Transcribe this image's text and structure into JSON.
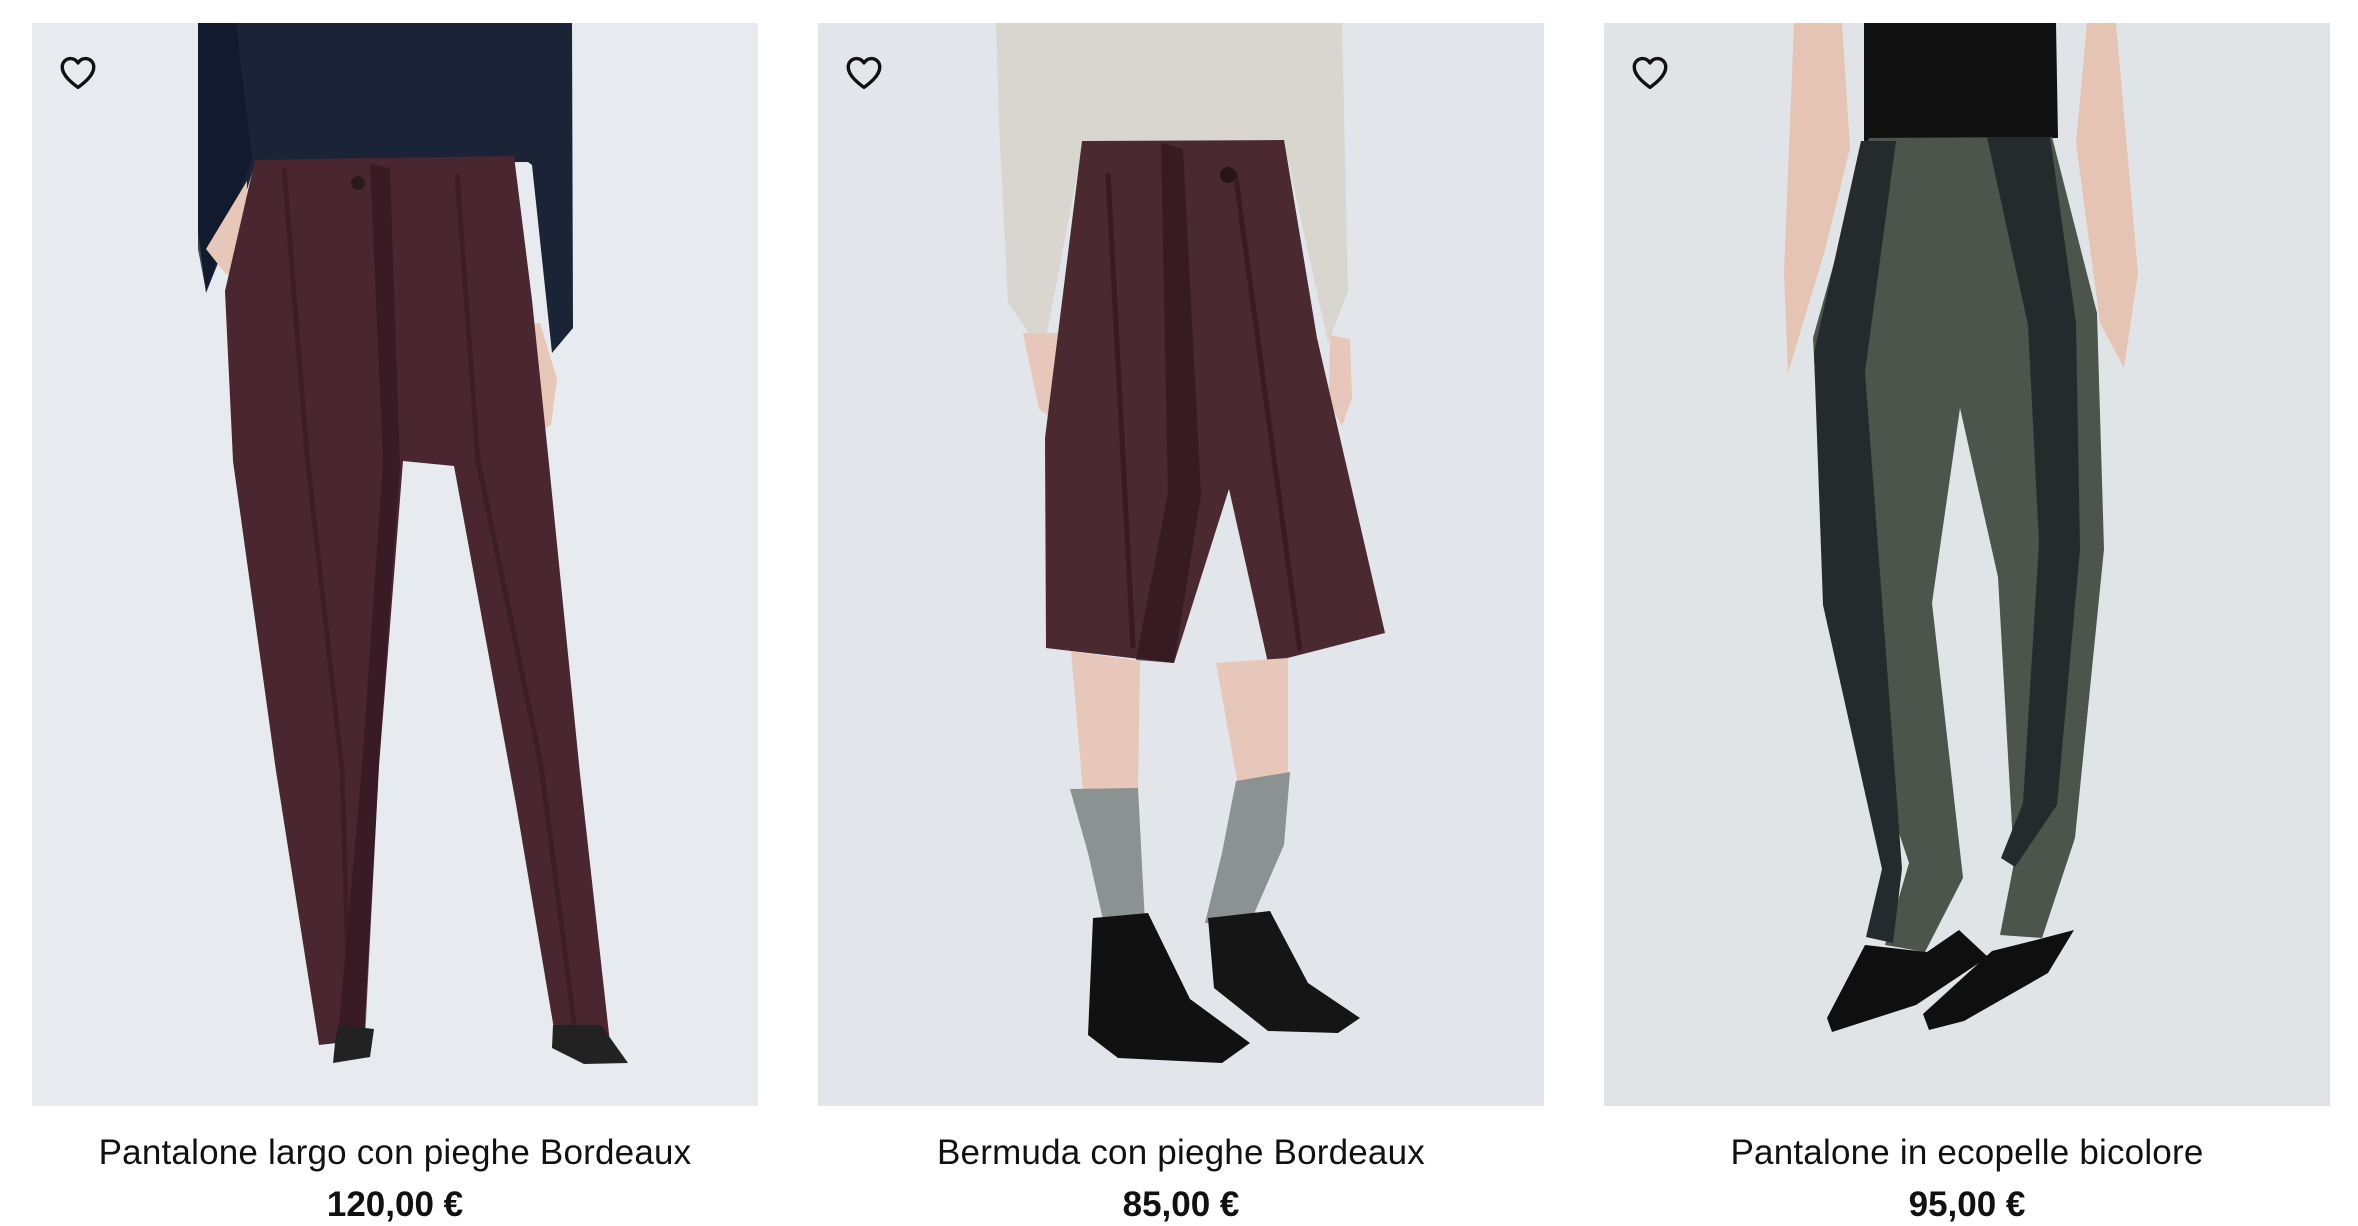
{
  "products": [
    {
      "title": "Pantalone largo con pieghe Bordeaux",
      "price": "120,00 €",
      "image": {
        "background": "#e7eaee",
        "garment": "#4a2730",
        "garment_shadow": "#31171f",
        "top": "#1b2337",
        "skin": "#e7c7b8",
        "shoe": "#222222",
        "sock": ""
      }
    },
    {
      "title": "Bermuda con pieghe Bordeaux",
      "price": "85,00 €",
      "image": {
        "background": "#e2e5e9",
        "garment": "#4a2930",
        "garment_shadow": "#2e171d",
        "top": "#d9d6d0",
        "skin": "#e6c7ba",
        "shoe": "#111111",
        "sock": "#8c9191"
      }
    },
    {
      "title": "Pantalone in ecopelle bicolore",
      "price": "95,00 €",
      "image": {
        "background": "#e1e4e6",
        "garment": "#4c544c",
        "garment_shadow": "#252b2d",
        "top": "#111111",
        "skin": "#e5c4b4",
        "shoe": "#0f0f0f",
        "sock": ""
      }
    }
  ],
  "icons": {
    "wishlist": "heart-outline-icon"
  }
}
